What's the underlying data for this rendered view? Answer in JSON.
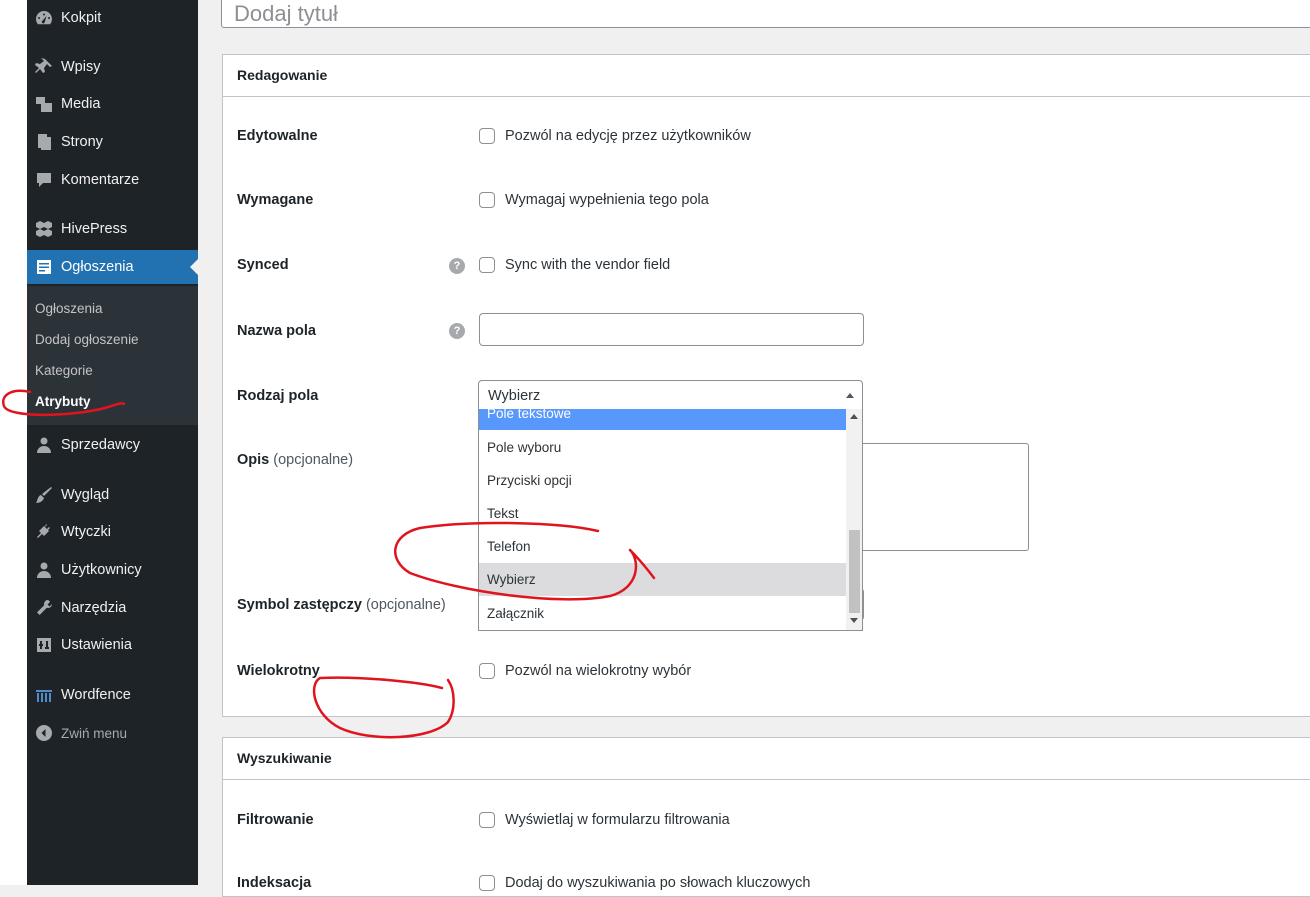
{
  "sidebar": {
    "menu": [
      {
        "label": "Kokpit",
        "icon": "dashboard-icon"
      },
      {
        "label": "Wpisy",
        "icon": "pin-icon"
      },
      {
        "label": "Media",
        "icon": "media-icon"
      },
      {
        "label": "Strony",
        "icon": "pages-icon"
      },
      {
        "label": "Komentarze",
        "icon": "comment-icon"
      },
      {
        "label": "HivePress",
        "icon": "hivepress-icon"
      },
      {
        "label": "Ogłoszenia",
        "icon": "listing-icon"
      },
      {
        "label": "Sprzedawcy",
        "icon": "user-icon"
      },
      {
        "label": "Wygląd",
        "icon": "brush-icon"
      },
      {
        "label": "Wtyczki",
        "icon": "plugin-icon"
      },
      {
        "label": "Użytkownicy",
        "icon": "users-icon"
      },
      {
        "label": "Narzędzia",
        "icon": "wrench-icon"
      },
      {
        "label": "Ustawienia",
        "icon": "settings-icon"
      },
      {
        "label": "Wordfence",
        "icon": "wordfence-icon"
      }
    ],
    "collapse_label": "Zwiń menu",
    "submenu": [
      "Ogłoszenia",
      "Dodaj ogłoszenie",
      "Kategorie",
      "Atrybuty"
    ]
  },
  "title_placeholder": "Dodaj tytuł",
  "editing_panel": {
    "header": "Redagowanie",
    "editable_label": "Edytowalne",
    "editable_cb": "Pozwól na edycję przez użytkowników",
    "required_label": "Wymagane",
    "required_cb": "Wymagaj wypełnienia tego pola",
    "synced_label": "Synced",
    "synced_cb": "Sync with the vendor field",
    "field_name_label": "Nazwa pola",
    "field_type_label": "Rodzaj pola",
    "field_type_value": "Wybierz",
    "field_type_options": [
      "Pole tekstowe",
      "Pole wyboru",
      "Przyciski opcji",
      "Tekst",
      "Telefon",
      "Wybierz",
      "Załącznik"
    ],
    "description_label": "Opis",
    "optional_hint": "(opcjonalne)",
    "placeholder_label": "Symbol zastępczy",
    "multiple_label": "Wielokrotny",
    "multiple_cb": "Pozwól na wielokrotny wybór"
  },
  "search_panel": {
    "header": "Wyszukiwanie",
    "filter_label": "Filtrowanie",
    "filter_cb": "Wyświetlaj w formularzu filtrowania",
    "index_label": "Indeksacja",
    "index_cb": "Dodaj do wyszukiwania po słowach kluczowych"
  },
  "colors": {
    "sidebar_bg": "#1d2327",
    "accent": "#2271b1",
    "highlight": "#5897fb",
    "annotation": "#e0141e"
  }
}
